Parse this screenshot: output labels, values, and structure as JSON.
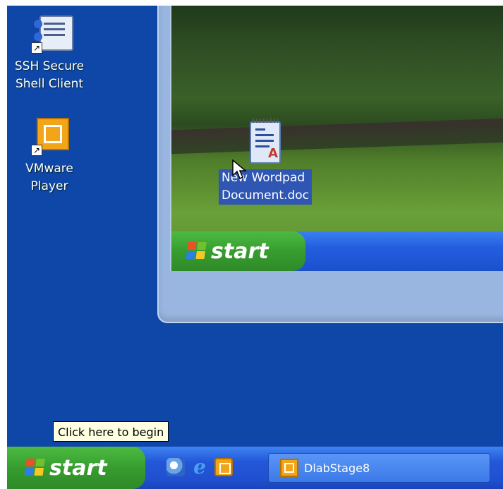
{
  "desktop": {
    "icons": [
      {
        "label_line1": "SSH Secure",
        "label_line2": "Shell Client",
        "icon": "ssh-client-icon"
      },
      {
        "label": "VMware Player",
        "icon": "vmware-player-icon"
      }
    ]
  },
  "vm": {
    "start_label": "start",
    "doc_label_line1": "New Wordpad",
    "doc_label_line2": "Document.doc",
    "doc_icon": "wordpad-document-icon"
  },
  "taskbar": {
    "start_label": "start",
    "tooltip": "Click here to begin",
    "quick_launch": [
      "outlook-express-icon",
      "internet-explorer-icon",
      "vmware-player-icon"
    ],
    "task_button_label": "DlabStage8"
  },
  "colors": {
    "desktop_bg": "#0f47a8",
    "taskbar_blue": "#2458d9",
    "start_green": "#379d2f",
    "selection": "#2f56b3",
    "tooltip_bg": "#ffffe1"
  }
}
